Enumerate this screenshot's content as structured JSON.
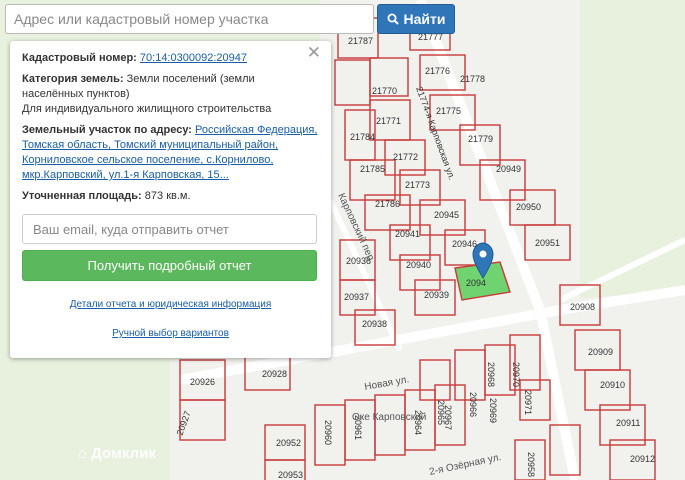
{
  "search": {
    "placeholder": "Адрес или кадастровый номер участка",
    "button_label": "Найти"
  },
  "panel": {
    "cad_label": "Кадастровый номер:",
    "cad_value": "70:14:0300092:20947",
    "cat_label": "Категория земель:",
    "cat_value": "Земли поселений (земли населённых пунктов)",
    "usage": "Для индивидуального жилищного строительства",
    "addr_label": "Земельный участок по адресу:",
    "addr_value": "Российская Федерация, Томская область, Томский муниципальный район, Корниловское сельское поселение, с.Корнилово, мкр.Карповский, ул.1-я Карповская, 15...",
    "area_label": "Уточненная площадь:",
    "area_value": "873 кв.м.",
    "email_placeholder": "Ваш email, куда отправить отчет",
    "report_button": "Получить подробный отчет",
    "details_link": "Детали отчета и юридическая информация",
    "manual_link": "Ручной выбор вариантов"
  },
  "map": {
    "parcels": [
      "21787",
      "21777",
      "21776",
      "21770",
      "21774-я Карповская ул.",
      "21775",
      "21778",
      "21771",
      "21784",
      "21779",
      "21772",
      "21785",
      "20949",
      "21773",
      "21786",
      "20950",
      "20945",
      "20941",
      "20951",
      "20946",
      "20936",
      "20940",
      "2094",
      "20937",
      "20939",
      "20938",
      "20908",
      "20970",
      "20926",
      "20968",
      "20965",
      "20928",
      "20909",
      "20971",
      "20966",
      "20910",
      "20967",
      "20969",
      "20927",
      "20911",
      "20952",
      "20960",
      "20961",
      "20964",
      "20912",
      "20953",
      "20958"
    ],
    "streets": [
      "Карповский пер.",
      "Новая ул.",
      "2-я Озёрная ул.",
      "Оке Карповский"
    ],
    "watermark": "Домклик"
  }
}
